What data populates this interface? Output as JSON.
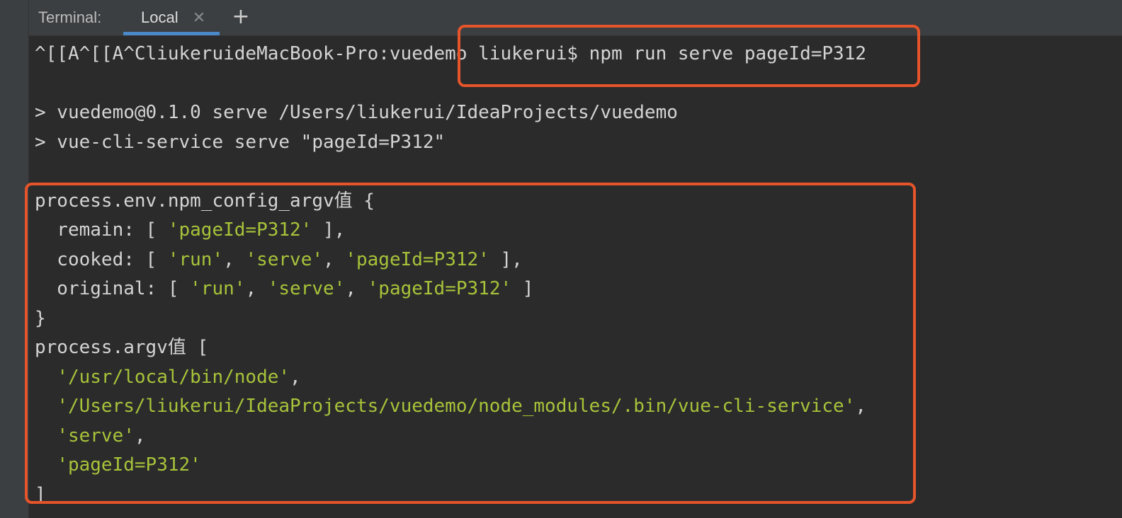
{
  "tabbar": {
    "title": "Terminal:",
    "active_tab": "Local",
    "close_glyph": "✕",
    "add_glyph": "+"
  },
  "terminal": {
    "lines": [
      "^[[A^[[A^CliukeruideMacBook-Pro:vuedemo liukerui$ npm run serve pageId=P312",
      "",
      "> vuedemo@0.1.0 serve /Users/liukerui/IdeaProjects/vuedemo",
      "> vue-cli-service serve \"pageId=P312\"",
      "",
      "process.env.npm_config_argv值 {",
      "  remain: [ 'pageId=P312' ],",
      "  cooked: [ 'run', 'serve', 'pageId=P312' ],",
      "  original: [ 'run', 'serve', 'pageId=P312' ]",
      "}",
      "process.argv值 [",
      "  '/usr/local/bin/node',",
      "  '/Users/liukerui/IdeaProjects/vuedemo/node_modules/.bin/vue-cli-service',",
      "  'serve',",
      "  'pageId=P312'",
      "]"
    ]
  },
  "colors": {
    "background": "#2b2b2b",
    "text": "#d4d4d4",
    "string": "#a7c33a",
    "highlight": "#e5542a",
    "tab_underline": "#4a88c7"
  }
}
